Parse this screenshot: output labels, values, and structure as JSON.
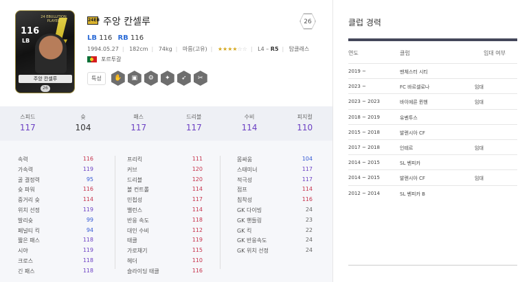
{
  "player": {
    "season_badge": "24EB",
    "name": "주앙 칸셀루",
    "level": "26",
    "positions": [
      {
        "pos": "LB",
        "ovr": "116"
      },
      {
        "pos": "RB",
        "ovr": "116"
      }
    ],
    "birth": "1994.05.27",
    "height": "182cm",
    "weight": "74kg",
    "body": "마름(고유)",
    "stars_on": "★★★★",
    "stars_off": "☆☆",
    "foot_prefix": "L4 – ",
    "foot_strong": "R5",
    "form": "탑클래스",
    "nation": "포르투갈",
    "traits_label": "특성"
  },
  "card": {
    "season_text": "24 EBULLITION PLAYER",
    "ovr": "116",
    "position": "LB",
    "name": "주앙 칸셀루",
    "level": "26"
  },
  "main_stats": [
    {
      "label": "스피드",
      "value": "117",
      "purple": true
    },
    {
      "label": "슛",
      "value": "104",
      "purple": false
    },
    {
      "label": "패스",
      "value": "117",
      "purple": true
    },
    {
      "label": "드리블",
      "value": "117",
      "purple": true
    },
    {
      "label": "수비",
      "value": "114",
      "purple": true
    },
    {
      "label": "피지컬",
      "value": "110",
      "purple": true
    }
  ],
  "detail_stats": {
    "col1": [
      {
        "label": "속력",
        "value": "116",
        "color": "red"
      },
      {
        "label": "가속력",
        "value": "119",
        "color": "purple"
      },
      {
        "label": "골 결정력",
        "value": "95",
        "color": "blue"
      },
      {
        "label": "슛 파워",
        "value": "116",
        "color": "red"
      },
      {
        "label": "중거리 슛",
        "value": "114",
        "color": "red"
      },
      {
        "label": "위치 선정",
        "value": "119",
        "color": "purple"
      },
      {
        "label": "발리슛",
        "value": "99",
        "color": "blue"
      },
      {
        "label": "페널티 킥",
        "value": "94",
        "color": "blue"
      },
      {
        "label": "짧은 패스",
        "value": "118",
        "color": "purple"
      },
      {
        "label": "시야",
        "value": "119",
        "color": "purple"
      },
      {
        "label": "크로스",
        "value": "118",
        "color": "purple"
      },
      {
        "label": "긴 패스",
        "value": "118",
        "color": "purple"
      }
    ],
    "col2": [
      {
        "label": "프리킥",
        "value": "111",
        "color": "red"
      },
      {
        "label": "커브",
        "value": "120",
        "color": "red"
      },
      {
        "label": "드리블",
        "value": "120",
        "color": "red"
      },
      {
        "label": "볼 컨트롤",
        "value": "114",
        "color": "red"
      },
      {
        "label": "민첩성",
        "value": "117",
        "color": "red"
      },
      {
        "label": "밸런스",
        "value": "114",
        "color": "red"
      },
      {
        "label": "반응 속도",
        "value": "118",
        "color": "red"
      },
      {
        "label": "대인 수비",
        "value": "112",
        "color": "red"
      },
      {
        "label": "태클",
        "value": "119",
        "color": "red"
      },
      {
        "label": "가로채기",
        "value": "115",
        "color": "red"
      },
      {
        "label": "헤더",
        "value": "110",
        "color": "red"
      },
      {
        "label": "슬라이딩 태클",
        "value": "116",
        "color": "red"
      }
    ],
    "col3": [
      {
        "label": "몸싸움",
        "value": "104",
        "color": "blue"
      },
      {
        "label": "스태미너",
        "value": "117",
        "color": "purple"
      },
      {
        "label": "적극성",
        "value": "117",
        "color": "purple"
      },
      {
        "label": "점프",
        "value": "114",
        "color": "red"
      },
      {
        "label": "침착성",
        "value": "116",
        "color": "red"
      },
      {
        "label": "GK 다이빙",
        "value": "24",
        "color": "gray"
      },
      {
        "label": "GK 핸들링",
        "value": "23",
        "color": "gray"
      },
      {
        "label": "GK 킥",
        "value": "22",
        "color": "gray"
      },
      {
        "label": "GK 반응속도",
        "value": "24",
        "color": "gray"
      },
      {
        "label": "GK 위치 선정",
        "value": "24",
        "color": "gray"
      }
    ]
  },
  "club_history": {
    "title": "클럽 경력",
    "headers": {
      "year": "연도",
      "club": "클럽",
      "loan": "임대 여부"
    },
    "rows": [
      {
        "year": "2019 ~",
        "club": "맨체스터 시티",
        "loan": ""
      },
      {
        "year": "2023 ~",
        "club": "FC 바르셀로나",
        "loan": "임대"
      },
      {
        "year": "2023 ~ 2023",
        "club": "바이에른 뮌헨",
        "loan": "임대"
      },
      {
        "year": "2018 ~ 2019",
        "club": "유벤투스",
        "loan": ""
      },
      {
        "year": "2015 ~ 2018",
        "club": "발렌시아 CF",
        "loan": ""
      },
      {
        "year": "2017 ~ 2018",
        "club": "인테르",
        "loan": "임대"
      },
      {
        "year": "2014 ~ 2015",
        "club": "SL 벤피카",
        "loan": ""
      },
      {
        "year": "2014 ~ 2015",
        "club": "발렌시아 CF",
        "loan": "임대"
      },
      {
        "year": "2012 ~ 2014",
        "club": "SL 벤피카 B",
        "loan": ""
      }
    ]
  },
  "colors": {
    "purple": "#6b3fc3",
    "red": "#c5304a",
    "blue": "#3358d4",
    "position_blue": "#2b6bd6",
    "star_gold": "#d5a81f"
  }
}
